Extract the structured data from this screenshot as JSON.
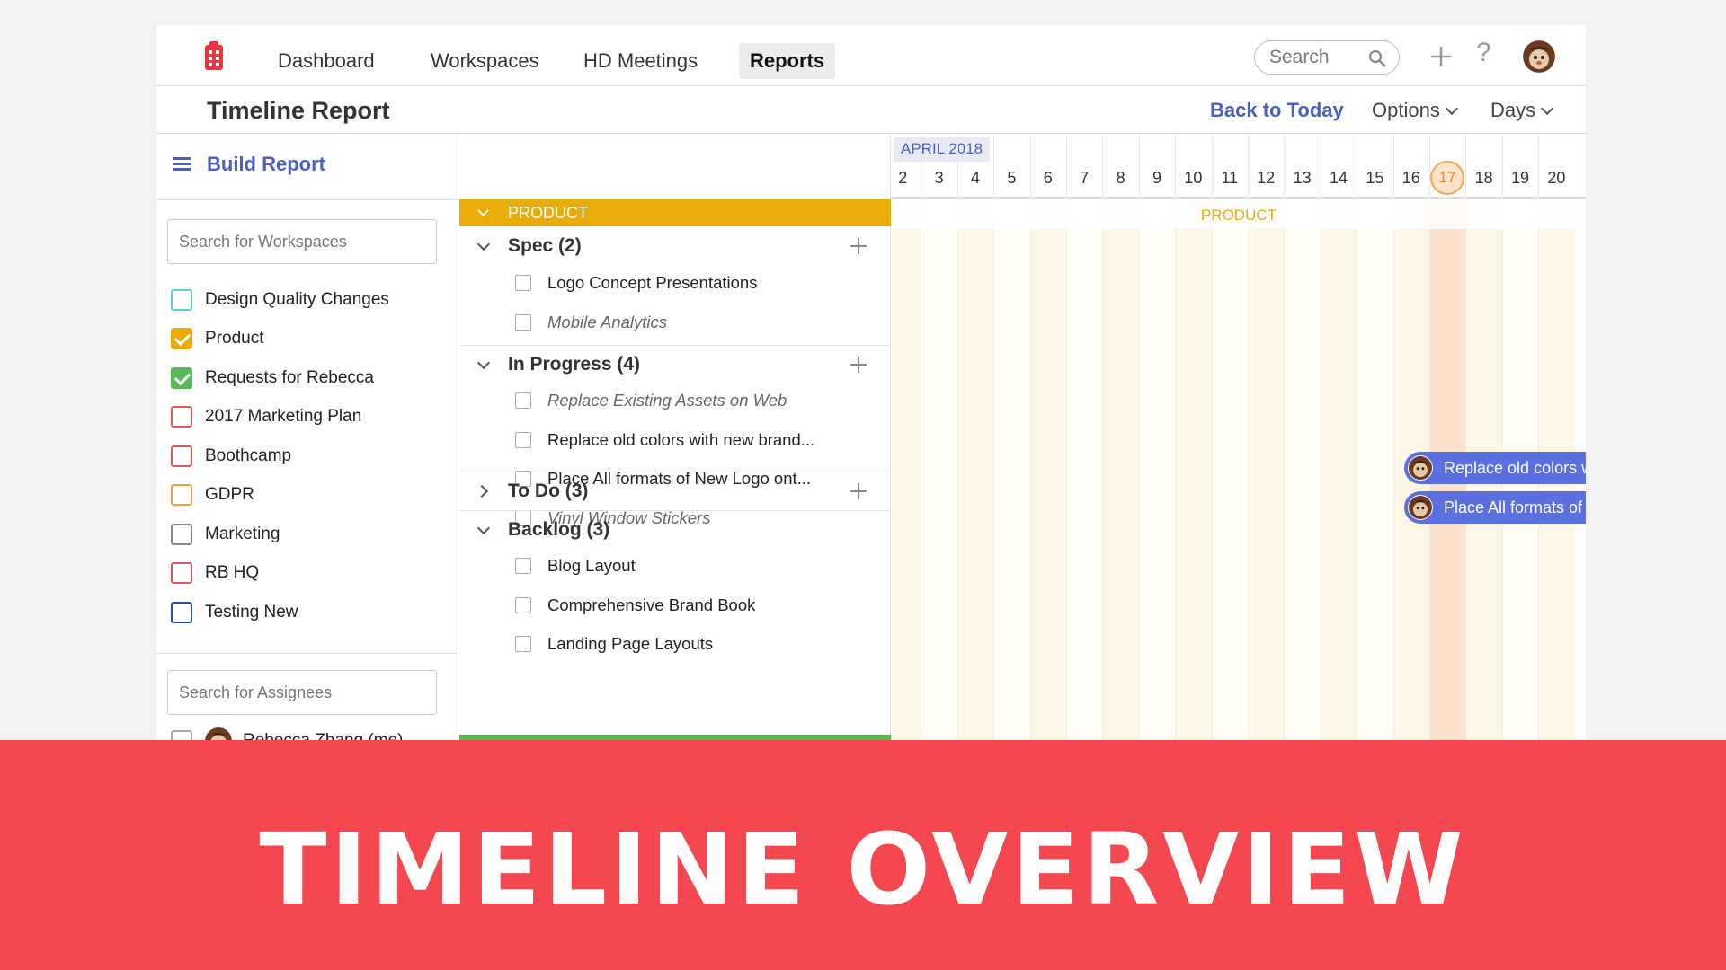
{
  "nav": {
    "items": [
      {
        "label": "Dashboard"
      },
      {
        "label": "Workspaces"
      },
      {
        "label": "HD Meetings"
      },
      {
        "label": "Reports"
      }
    ],
    "search_placeholder": "Search"
  },
  "header": {
    "title": "Timeline Report",
    "back_to_today": "Back to Today",
    "options": "Options",
    "days": "Days"
  },
  "sidebar": {
    "build_report": "Build Report",
    "workspace_search_placeholder": "Search for Workspaces",
    "workspaces": [
      {
        "label": "Design Quality Changes",
        "checked": false,
        "color": "#5fcfd4"
      },
      {
        "label": "Product",
        "checked": true,
        "color": "#e9ac08"
      },
      {
        "label": "Requests for Rebecca",
        "checked": true,
        "color": "#5ab85a"
      },
      {
        "label": "2017 Marketing Plan",
        "checked": false,
        "color": "#e05a5a"
      },
      {
        "label": "Boothcamp",
        "checked": false,
        "color": "#e05a5a"
      },
      {
        "label": "GDPR",
        "checked": false,
        "color": "#f0a040"
      },
      {
        "label": "Marketing",
        "checked": false,
        "color": "#888888"
      },
      {
        "label": "RB HQ",
        "checked": false,
        "color": "#e05a5a"
      },
      {
        "label": "Testing New",
        "checked": false,
        "color": "#2a4fa8"
      }
    ],
    "assignee_search_placeholder": "Search for Assignees",
    "assignee": "Rebecca Zhang (me)"
  },
  "tasks": {
    "workspace_band": "PRODUCT",
    "groups": [
      {
        "label": "Spec (2)",
        "expanded": true,
        "tasks": [
          {
            "label": "Logo Concept Presentations",
            "italic": false
          },
          {
            "label": "Mobile Analytics",
            "italic": true
          }
        ]
      },
      {
        "label": "In Progress (4)",
        "expanded": true,
        "tasks": [
          {
            "label": "Replace Existing Assets on Web",
            "italic": true
          },
          {
            "label": "Replace old colors with new brand...",
            "italic": false
          },
          {
            "label": "Place All formats of New Logo ont...",
            "italic": false
          },
          {
            "label": "Vinyl Window Stickers",
            "italic": true
          }
        ]
      },
      {
        "label": "To Do (3)",
        "expanded": false,
        "tasks": []
      },
      {
        "label": "Backlog (3)",
        "expanded": true,
        "tasks": [
          {
            "label": "Blog Layout",
            "italic": false
          },
          {
            "label": "Comprehensive Brand Book",
            "italic": false
          },
          {
            "label": "Landing Page Layouts",
            "italic": false
          }
        ]
      }
    ]
  },
  "timeline": {
    "month": "APRIL 2018",
    "days": [
      "2",
      "3",
      "4",
      "5",
      "6",
      "7",
      "8",
      "9",
      "10",
      "11",
      "12",
      "13",
      "14",
      "15",
      "16",
      "17",
      "18",
      "19",
      "20"
    ],
    "today": "17",
    "workspace_label": "PRODUCT",
    "bars": [
      {
        "label": "Replace old colors with new brand..."
      },
      {
        "label": "Place All formats of New Logo ont..."
      }
    ]
  },
  "banner": {
    "text": "TIMELINE OVERVIEW"
  },
  "colors": {
    "accent": "#4a5fc1",
    "product": "#e9ac08",
    "bar": "#5a6fe0",
    "today": "#f0a856",
    "banner": "#f4474f"
  }
}
